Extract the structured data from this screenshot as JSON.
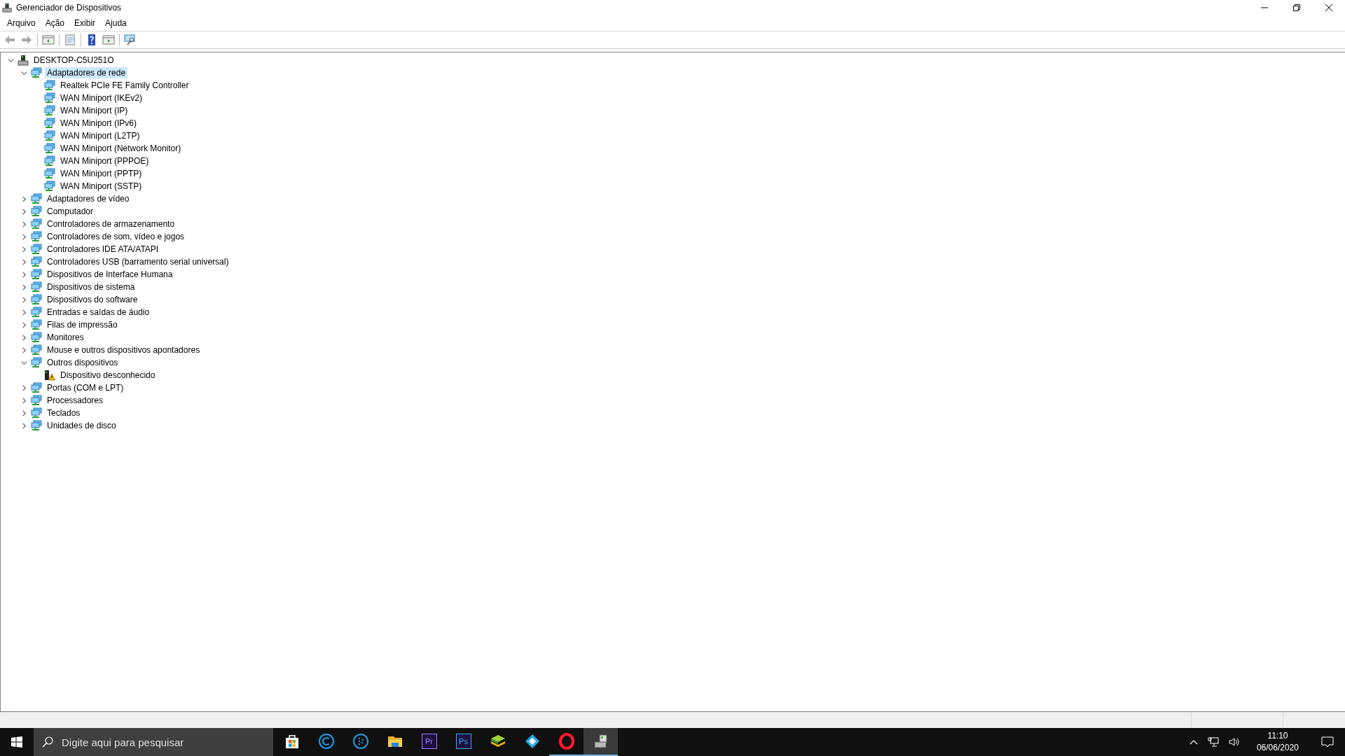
{
  "window": {
    "title": "Gerenciador de Dispositivos"
  },
  "menu": [
    "Arquivo",
    "Ação",
    "Exibir",
    "Ajuda"
  ],
  "toolbar": [
    {
      "kind": "back",
      "disabled": true
    },
    {
      "kind": "forward",
      "disabled": true
    },
    {
      "kind": "sep"
    },
    {
      "kind": "panel"
    },
    {
      "kind": "sep"
    },
    {
      "kind": "props"
    },
    {
      "kind": "sep"
    },
    {
      "kind": "help"
    },
    {
      "kind": "panel2"
    },
    {
      "kind": "sep"
    },
    {
      "kind": "scan"
    }
  ],
  "tree": [
    {
      "label": "DESKTOP-C5U251O",
      "selected": false,
      "expanded": true,
      "children": [
        {
          "label": "Adaptadores de rede",
          "selected": true,
          "expanded": true,
          "children": [
            {
              "label": "Realtek PCIe FE Family Controller",
              "selected": false,
              "warning": false
            },
            {
              "label": "WAN Miniport (IKEv2)",
              "selected": false,
              "warning": false
            },
            {
              "label": "WAN Miniport (IP)",
              "selected": false,
              "warning": false
            },
            {
              "label": "WAN Miniport (IPv6)",
              "selected": false,
              "warning": false
            },
            {
              "label": "WAN Miniport (L2TP)",
              "selected": false,
              "warning": false
            },
            {
              "label": "WAN Miniport (Network Monitor)",
              "selected": false,
              "warning": false
            },
            {
              "label": "WAN Miniport (PPPOE)",
              "selected": false,
              "warning": false
            },
            {
              "label": "WAN Miniport (PPTP)",
              "selected": false,
              "warning": false
            },
            {
              "label": "WAN Miniport (SSTP)",
              "selected": false,
              "warning": false
            }
          ]
        },
        {
          "label": "Adaptadores de vídeo",
          "selected": false,
          "expanded": false
        },
        {
          "label": "Computador",
          "selected": false,
          "expanded": false
        },
        {
          "label": "Controladores de armazenamento",
          "selected": false,
          "expanded": false
        },
        {
          "label": "Controladores de som, vídeo e jogos",
          "selected": false,
          "expanded": false
        },
        {
          "label": "Controladores IDE ATA/ATAPI",
          "selected": false,
          "expanded": false
        },
        {
          "label": "Controladores USB (barramento serial universal)",
          "selected": false,
          "expanded": false
        },
        {
          "label": "Dispositivos de Interface Humana",
          "selected": false,
          "expanded": false
        },
        {
          "label": "Dispositivos de sistema",
          "selected": false,
          "expanded": false
        },
        {
          "label": "Dispositivos do software",
          "selected": false,
          "expanded": false
        },
        {
          "label": "Entradas e saídas de áudio",
          "selected": false,
          "expanded": false
        },
        {
          "label": "Filas de impressão",
          "selected": false,
          "expanded": false
        },
        {
          "label": "Monitores",
          "selected": false,
          "expanded": false
        },
        {
          "label": "Mouse e outros dispositivos apontadores",
          "selected": false,
          "expanded": false
        },
        {
          "label": "Outros dispositivos",
          "selected": false,
          "expanded": true,
          "children": [
            {
              "label": "Dispositivo desconhecido",
              "selected": false,
              "warning": true
            }
          ]
        },
        {
          "label": "Portas (COM e LPT)",
          "selected": false,
          "expanded": false
        },
        {
          "label": "Processadores",
          "selected": false,
          "expanded": false
        },
        {
          "label": "Teclados",
          "selected": false,
          "expanded": false
        },
        {
          "label": "Unidades de disco",
          "selected": false,
          "expanded": false
        }
      ]
    }
  ],
  "taskbar": {
    "search": {
      "placeholder": "Digite aqui para pesquisar"
    },
    "apps": [
      {
        "kind": "store",
        "running": false,
        "selected": false
      },
      {
        "kind": "c-circle",
        "running": false,
        "selected": false
      },
      {
        "kind": "dots",
        "running": false,
        "selected": false
      },
      {
        "kind": "folder",
        "running": false,
        "selected": false
      },
      {
        "kind": "text",
        "label": "Pr",
        "color": "#9a7bff",
        "running": false,
        "selected": false
      },
      {
        "kind": "text",
        "label": "Ps",
        "color": "#31a8ff",
        "running": false,
        "selected": false
      },
      {
        "kind": "stack",
        "running": false,
        "selected": false
      },
      {
        "kind": "diamond",
        "running": false,
        "selected": false
      },
      {
        "kind": "ring",
        "running": true,
        "selected": false
      },
      {
        "kind": "device",
        "running": true,
        "selected": true
      }
    ],
    "time": "11:10",
    "date": "06/06/2020"
  }
}
